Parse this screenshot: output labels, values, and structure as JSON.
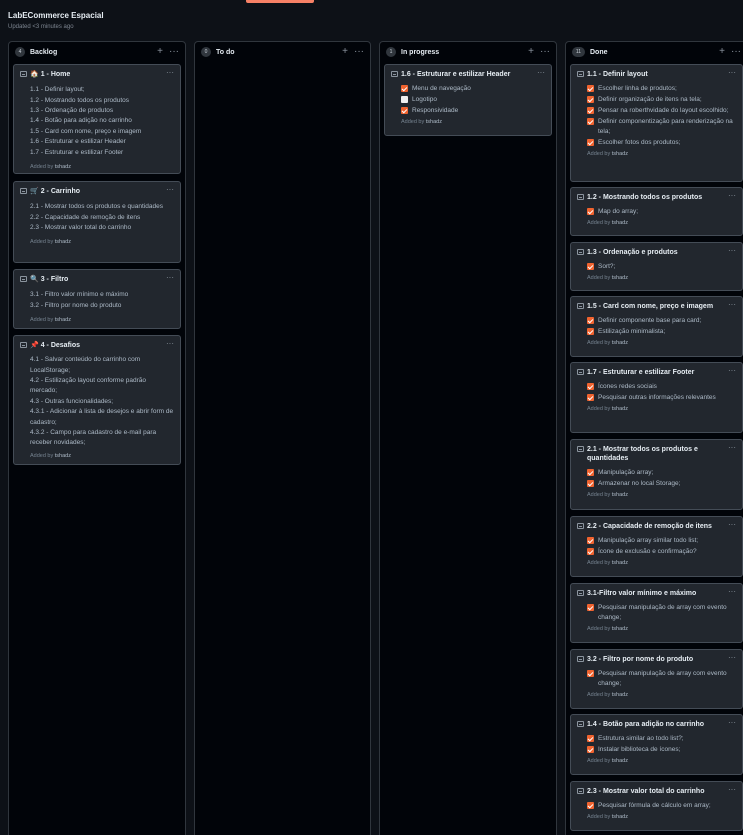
{
  "project": {
    "title": "LabECommerce Espacial",
    "updated": "Updated <3 minutes ago"
  },
  "icons": {
    "add": "plus-icon",
    "more": "kebab-menu-icon",
    "note": "note-icon",
    "checkbox": "checkbox-icon"
  },
  "colors": {
    "checked": "#f0632f",
    "accent_tab": "#f78166"
  },
  "columns": {
    "backlog": {
      "count": "4",
      "name": "Backlog",
      "cards": [
        {
          "emoji": "🏠",
          "title": "1 - Home",
          "lines": [
            "1.1 - Definir layout;",
            "1.2 - Mostrando todos os produtos",
            "1.3 - Ordenação de produtos",
            "1.4 - Botão para adição no carrinho",
            "1.5 - Card com nome, preço e imagem",
            "1.6 - Estruturar e estilizar Header",
            "1.7 - Estruturar e estilizar Footer"
          ],
          "added_prefix": "Added by",
          "author": "tshadz"
        },
        {
          "emoji": "🛒",
          "title": "2 - Carrinho",
          "lines": [
            "2.1 - Mostrar todos os produtos e quantidades",
            "2.2 - Capacidade de remoção de itens",
            "2.3 - Mostrar valor total do carrinho"
          ],
          "added_prefix": "Added by",
          "author": "tshadz"
        },
        {
          "emoji": "🔍",
          "title": "3 - Filtro",
          "lines": [
            "3.1 - Filtro valor mínimo e máximo",
            "3.2 - Filtro por nome do produto"
          ],
          "added_prefix": "Added by",
          "author": "tshadz"
        },
        {
          "emoji": "📌",
          "title": "4 - Desafios",
          "lines": [
            "4.1 - Salvar conteúdo do carrinho com LocalStorage;",
            "4.2 - Estilização layout conforme padrão mercado;",
            "4.3 - Outras funcionalidades;",
            "4.3.1 - Adicionar à lista de desejos e abrir form de cadastro;",
            "4.3.2 - Campo para cadastro de e-mail para receber novidades;"
          ],
          "added_prefix": "Added by",
          "author": "tshadz"
        }
      ]
    },
    "todo": {
      "count": "0",
      "name": "To do"
    },
    "progress": {
      "count": "1",
      "name": "In progress",
      "cards": [
        {
          "title": "1.6 - Estruturar e estilizar Header",
          "items": [
            {
              "text": "Menu de navegação",
              "checked": true
            },
            {
              "text": "Logotipo",
              "checked": false
            },
            {
              "text": "Responsividade",
              "checked": true
            }
          ],
          "added_prefix": "Added by",
          "author": "tshadz"
        }
      ]
    },
    "done": {
      "count": "11",
      "name": "Done",
      "cards": [
        {
          "title": "1.1 - Definir layout",
          "items": [
            "Escolher linha de produtos;",
            "Definir organização de itens na tela;",
            "Pensar na roberthvidade do layout escolhido;",
            "Definir componentização para renderização na tela;",
            "Escolher fotos dos produtos;"
          ],
          "added_prefix": "Added by",
          "author": "tshadz"
        },
        {
          "title": "1.2 - Mostrando todos os produtos",
          "items": [
            "Map do array;"
          ],
          "added_prefix": "Added by",
          "author": "tshadz"
        },
        {
          "title": "1.3 - Ordenação e produtos",
          "items": [
            "Sort?;"
          ],
          "added_prefix": "Added by",
          "author": "tshadz"
        },
        {
          "title": "1.5 - Card com nome, preço e imagem",
          "items": [
            "Definir componente base para card;",
            "Estilização minimalista;"
          ],
          "added_prefix": "Added by",
          "author": "tshadz"
        },
        {
          "title": "1.7 - Estruturar e estilizar Footer",
          "items": [
            "Ícones redes sociais",
            "Pesquisar outras informações relevantes"
          ],
          "added_prefix": "Added by",
          "author": "tshadz"
        },
        {
          "title": "2.1 - Mostrar todos os produtos e quantidades",
          "items": [
            "Manipulação array;",
            "Armazenar no local Storage;"
          ],
          "added_prefix": "Added by",
          "author": "tshadz"
        },
        {
          "title": "2.2 - Capacidade de remoção de itens",
          "items": [
            "Manipulação array similar todo list;",
            "Ícone de exclusão e confirmação?"
          ],
          "added_prefix": "Added by",
          "author": "tshadz"
        },
        {
          "title": "3.1-Filtro valor mínimo e máximo",
          "items": [
            "Pesquisar manipulação de array com evento change;"
          ],
          "added_prefix": "Added by",
          "author": "tshadz"
        },
        {
          "title": "3.2 - Filtro por nome do produto",
          "items": [
            "Pesquisar manipulação de array com evento change;"
          ],
          "added_prefix": "Added by",
          "author": "tshadz"
        },
        {
          "title": "1.4 - Botão para adição no carrinho",
          "items": [
            "Estrutura similar ao todo list?;",
            "Instalar biblioteca de ícones;"
          ],
          "added_prefix": "Added by",
          "author": "tshadz"
        },
        {
          "title": "2.3 - Mostrar valor total do carrinho",
          "items": [
            "Pesquisar fórmula de cálculo em array;"
          ],
          "added_prefix": "Added by",
          "author": "tshadz"
        }
      ]
    }
  }
}
